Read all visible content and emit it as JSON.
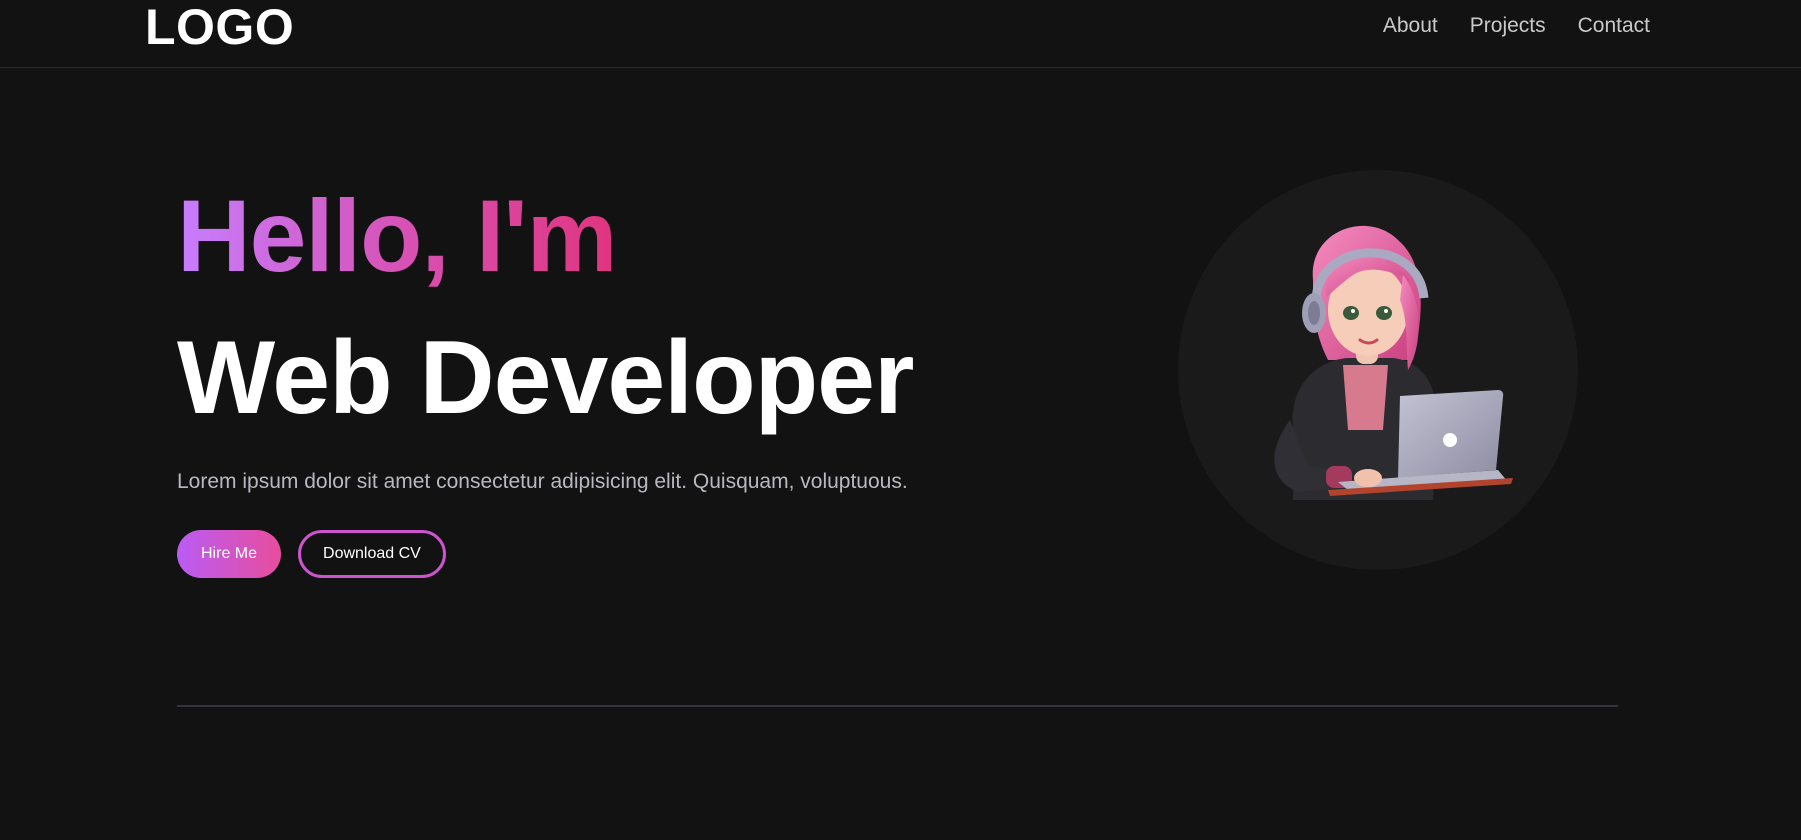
{
  "header": {
    "logo": "LOGO",
    "nav": [
      {
        "label": "About"
      },
      {
        "label": "Projects"
      },
      {
        "label": "Contact"
      }
    ]
  },
  "hero": {
    "greeting": "Hello, I'm",
    "role": "Web Developer",
    "description": "Lorem ipsum dolor sit amet consectetur adipisicing elit. Quisquam, voluptuous.",
    "buttons": {
      "hire": "Hire Me",
      "download": "Download CV"
    },
    "illustration": "girl-with-headphones-laptop-illustration"
  },
  "colors": {
    "background": "#121212",
    "accent_purple": "#c77dff",
    "accent_pink": "#e0357f"
  }
}
